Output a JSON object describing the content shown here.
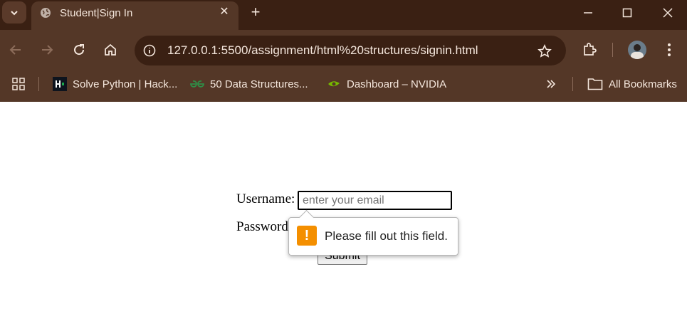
{
  "browser": {
    "tab_title": "Student|Sign In",
    "url": "127.0.0.1:5500/assignment/html%20structures/signin.html",
    "bookmarks": [
      {
        "label": "Solve Python | Hack...",
        "icon": "hackerrank-icon"
      },
      {
        "label": "50 Data Structures...",
        "icon": "geeksforgeeks-icon"
      },
      {
        "label": "Dashboard – NVIDIA",
        "icon": "nvidia-icon"
      }
    ],
    "all_bookmarks_label": "All Bookmarks",
    "colors": {
      "frame": "#3a2013",
      "toolbar": "#543727",
      "text": "#f4e6dc"
    }
  },
  "form": {
    "username_label": "Username:",
    "username_placeholder": "enter your email",
    "password_label": "Password",
    "submit_label": "Submit"
  },
  "validation": {
    "message": "Please fill out this field.",
    "icon": "!",
    "icon_color": "#f48f00"
  }
}
